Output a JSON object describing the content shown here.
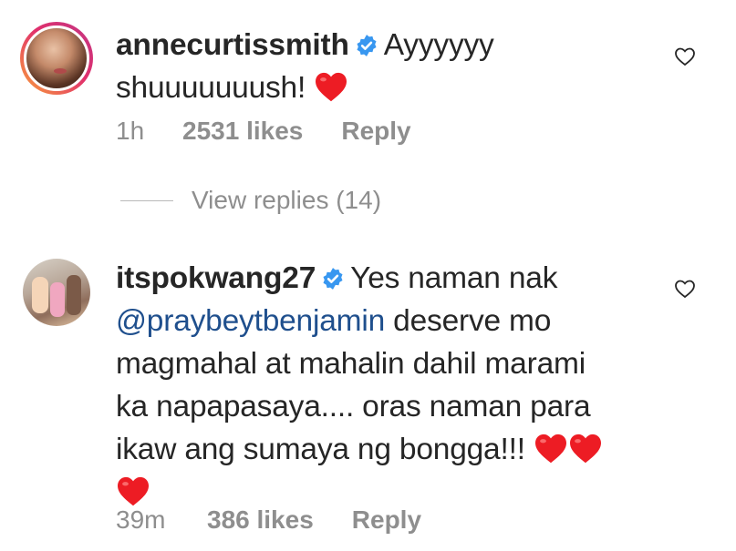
{
  "comments": [
    {
      "username": "annecurtissmith",
      "text_line1": "Ayyyyyy",
      "text_line2": "shuuuuuuush!",
      "time": "1h",
      "likes": "2531 likes",
      "reply": "Reply"
    },
    {
      "username": "itspokwang27",
      "text_line1": "Yes naman nak",
      "mention": "@praybeytbenjamin",
      "text_line2": " deserve mo",
      "text_line3": "magmahal at mahalin dahil marami",
      "text_line4": "ka napapasaya.... oras naman para",
      "text_line5": "ikaw ang sumaya ng bongga!!! ",
      "time": "39m",
      "likes": "386 likes",
      "reply": "Reply"
    }
  ],
  "view_replies": "View replies (14)",
  "colors": {
    "mention": "#1f4f8d",
    "muted": "#8e8e8e",
    "verified": "#3897f0",
    "heart": "#ed1c24"
  }
}
